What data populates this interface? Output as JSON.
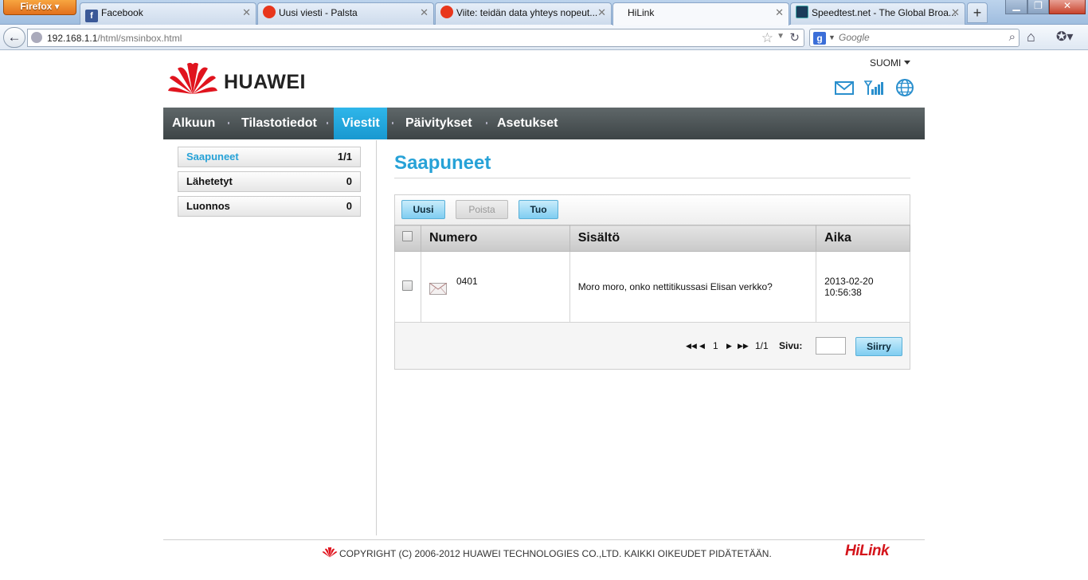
{
  "browser": {
    "firefox_label": "Firefox",
    "tabs": [
      {
        "title": "Facebook",
        "favicon": "f"
      },
      {
        "title": "Uusi viesti - Palsta",
        "favicon": ""
      },
      {
        "title": "Viite: teidän data yhteys nopeut...",
        "favicon": ""
      },
      {
        "title": "HiLink",
        "favicon": ""
      },
      {
        "title": "Speedtest.net - The Global Broa...",
        "favicon": ""
      }
    ],
    "new_tab": "+",
    "url_host": "192.168.1.1",
    "url_path": "/html/smsinbox.html",
    "search_engine": "g",
    "search_placeholder": "Google"
  },
  "header": {
    "logo_text": "HUAWEI",
    "language": "SUOMI"
  },
  "nav": {
    "items": [
      {
        "label": "Alkuun"
      },
      {
        "label": "Tilastotiedot"
      },
      {
        "label": "Viestit"
      },
      {
        "label": "Päivitykset"
      },
      {
        "label": "Asetukset"
      }
    ]
  },
  "sidebar": {
    "items": [
      {
        "label": "Saapuneet",
        "count": "1/1"
      },
      {
        "label": "Lähetetyt",
        "count": "0"
      },
      {
        "label": "Luonnos",
        "count": "0"
      }
    ]
  },
  "main": {
    "title": "Saapuneet",
    "toolbar": {
      "new_label": "Uusi",
      "delete_label": "Poista",
      "import_label": "Tuo"
    },
    "table": {
      "columns": [
        "Numero",
        "Sisältö",
        "Aika"
      ],
      "rows": [
        {
          "number": "0401",
          "content": "Moro moro, onko nettitikussasi Elisan verkko?",
          "date": "2013-02-20",
          "time": "10:56:38"
        }
      ]
    },
    "pager": {
      "first": "◀◀",
      "prev": "◀",
      "current": "1",
      "next": "▶",
      "last": "▶▶",
      "total": "1/1",
      "page_label": "Sivu:",
      "goto_label": "Siirry"
    }
  },
  "footer": {
    "copyright": "COPYRIGHT (C) 2006-2012 HUAWEI TECHNOLOGIES CO.,LTD. KAIKKI OIKEUDET PIDÄTETÄÄN.",
    "brand": "HiLink"
  },
  "colors": {
    "accent": "#27a2d7",
    "nav_bg": "#4a5254",
    "brand_red": "#d4141b"
  }
}
